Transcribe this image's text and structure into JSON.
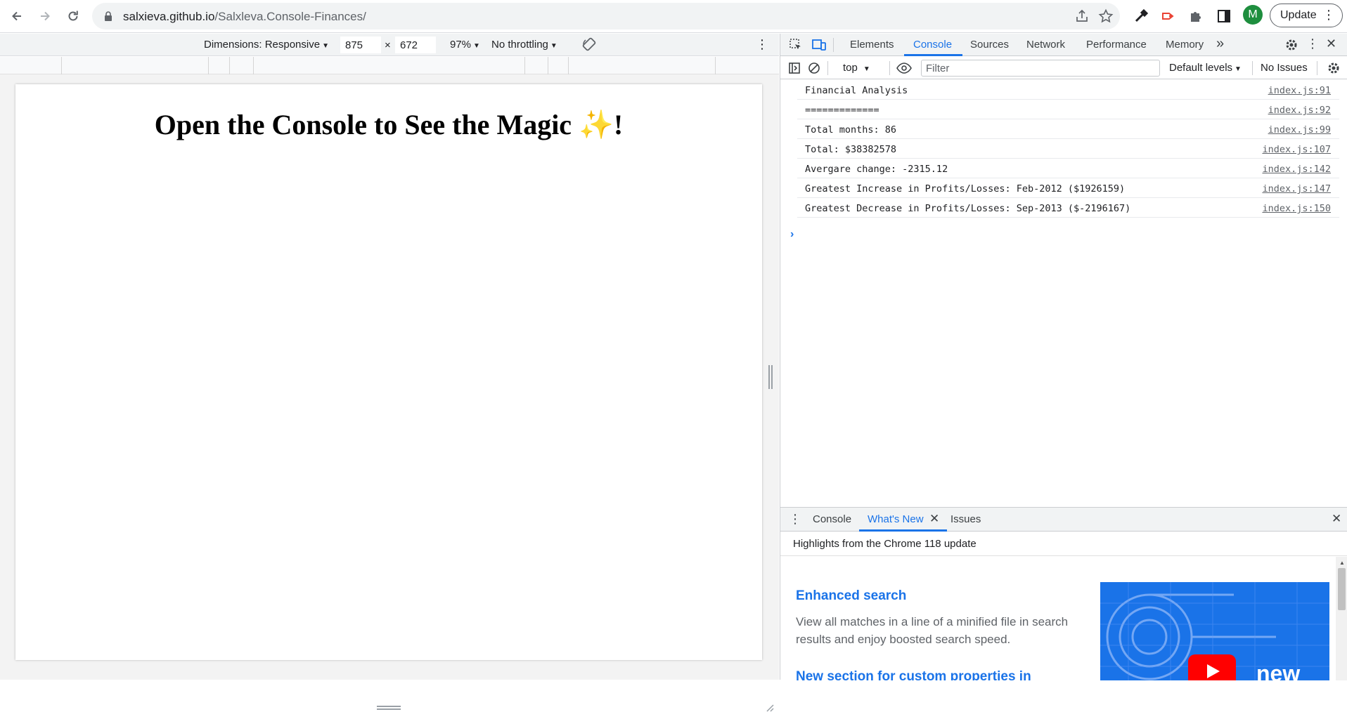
{
  "browser": {
    "url_host": "salxieva.github.io",
    "url_path": "/Salxleva.Console-Finances/",
    "avatar_letter": "M",
    "update_label": "Update",
    "icons": [
      "back-icon",
      "forward-icon",
      "reload-icon",
      "lock-icon",
      "share-icon",
      "star-icon",
      "eyedropper-icon",
      "extension-red-icon",
      "puzzle-icon",
      "side-panel-icon",
      "kebab-menu-icon"
    ]
  },
  "device_toolbar": {
    "dimensions_label": "Dimensions: Responsive",
    "width_value": "875",
    "times": "×",
    "height_value": "672",
    "zoom_label": "97%",
    "throttling_label": "No throttling",
    "icons": [
      "rotate-icon",
      "more-options-icon"
    ]
  },
  "page": {
    "heading": "Open the Console to See the Magic",
    "sparkle": "✨",
    "heading_suffix": "!"
  },
  "devtools": {
    "tabs": [
      "Elements",
      "Console",
      "Sources",
      "Network",
      "Performance",
      "Memory"
    ],
    "active_tab": "Console",
    "more_tabs_glyph": "»",
    "context_label": "top",
    "filter_placeholder": "Filter",
    "levels_label": "Default levels",
    "issues_label": "No Issues",
    "console_lines": [
      {
        "text": "Financial Analysis",
        "source": "index.js:91"
      },
      {
        "text": "=============",
        "source": "index.js:92"
      },
      {
        "text": "Total months: 86",
        "source": "index.js:99"
      },
      {
        "text": "Total: $38382578",
        "source": "index.js:107"
      },
      {
        "text": "Avergare change: -2315.12",
        "source": "index.js:142"
      },
      {
        "text": "Greatest Increase in Profits/Losses: Feb-2012 ($1926159)",
        "source": "index.js:147"
      },
      {
        "text": "Greatest Decrease in Profits/Losses: Sep-2013 ($-2196167)",
        "source": "index.js:150"
      }
    ],
    "prompt_glyph": "›",
    "drawer": {
      "tabs": [
        "Console",
        "What's New",
        "Issues"
      ],
      "active_tab": "What's New",
      "subtitle": "Highlights from the Chrome 118 update",
      "feature1_title": "Enhanced search",
      "feature1_desc": "View all matches in a line of a minified file in search results and enjoy boosted search speed.",
      "feature2_title": "New section for custom properties in",
      "video_badge": "new"
    }
  },
  "colors": {
    "accent": "#1a73e8",
    "avatar_bg": "#1e8e3e",
    "sparkle": "#f4c430",
    "toolbar_bg": "#f1f3f4"
  }
}
